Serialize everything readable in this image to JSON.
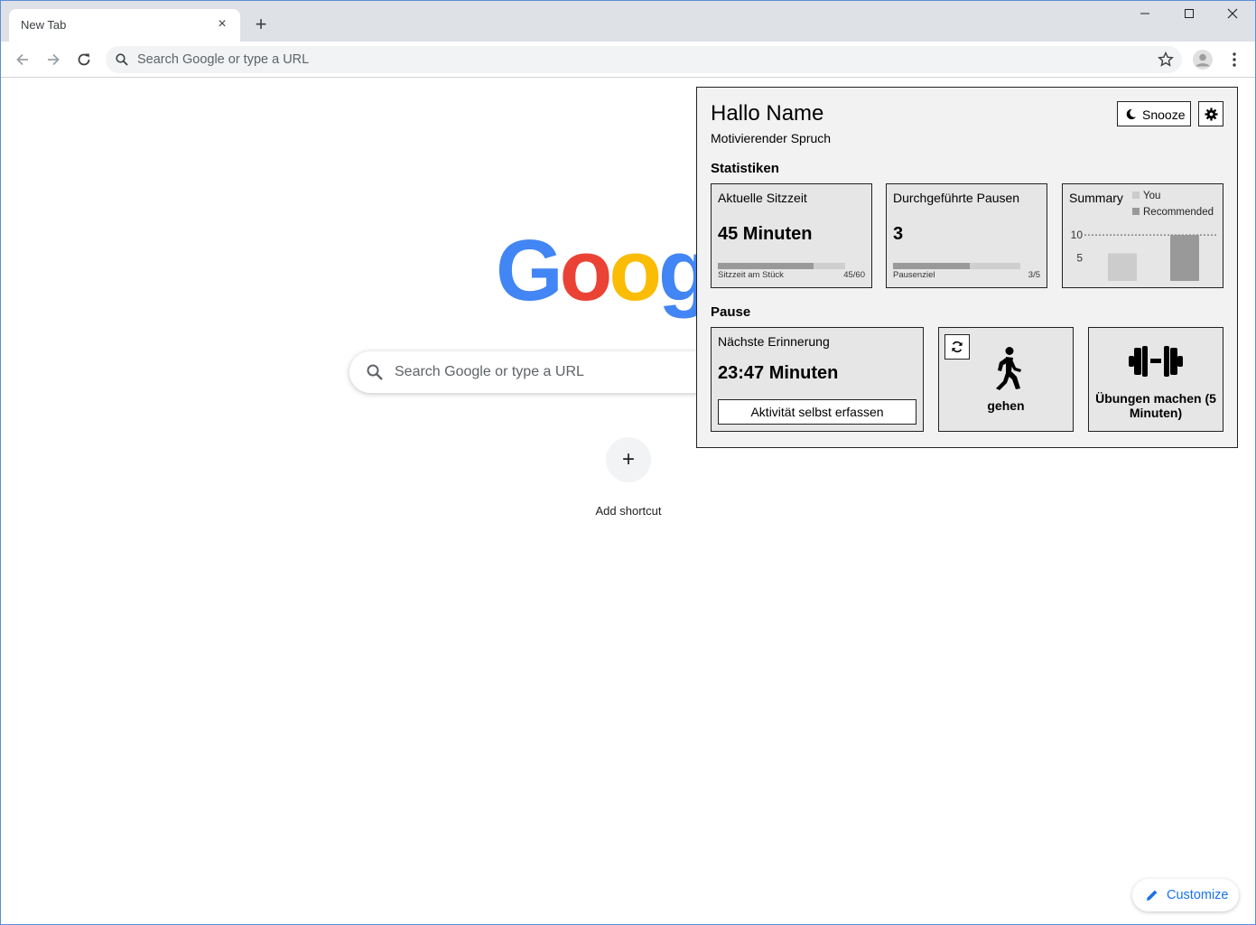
{
  "browser": {
    "tab_title": "New Tab",
    "tab_close": "×",
    "new_tab": "+",
    "window_controls": {
      "minimize": "—",
      "maximize": "☐",
      "close": "✕"
    },
    "omnibox_placeholder": "Search Google or type a URL",
    "icons": [
      "back-icon",
      "forward-icon",
      "reload-icon",
      "search-icon",
      "star-icon",
      "avatar-icon",
      "menu-dots-icon"
    ]
  },
  "ntp": {
    "logo_letters": [
      "G",
      "o",
      "o",
      "g"
    ],
    "logo_colors": [
      "#4285f4",
      "#ea4335",
      "#fbbc05",
      "#4285f4"
    ],
    "search_placeholder": "Search Google or type a URL",
    "add_shortcut_icon": "+",
    "add_shortcut_label": "Add shortcut",
    "customize_label": "Customize"
  },
  "panel": {
    "greeting": "Hallo Name",
    "motto": "Motivierender Spruch",
    "snooze_label": "Snooze",
    "statistics_title": "Statistiken",
    "sitting_card": {
      "title": "Aktuelle Sitzzeit",
      "value": "45 Minuten",
      "bar_label": "Sitzzeit am Stück",
      "bar_value": "45/60",
      "progress": 0.75
    },
    "breaks_card": {
      "title": "Durchgeführte Pausen",
      "value": "3",
      "bar_label": "Pausenziel",
      "bar_value": "3/5",
      "progress": 0.6
    },
    "summary_card": {
      "title": "Summary",
      "legend": [
        {
          "label": "You",
          "color": "#cccccc"
        },
        {
          "label": "Recommended",
          "color": "#999999"
        }
      ],
      "tick_10": "10",
      "tick_5": "5"
    },
    "pause_title": "Pause",
    "reminder_card": {
      "title": "Nächste Erinnerung",
      "value": "23:47 Minuten",
      "button_label": "Aktivität selbst erfassen"
    },
    "walk_card": {
      "label": "gehen"
    },
    "exercise_card": {
      "label": "Übungen machen (5 Minuten)"
    },
    "colors": {
      "panel_bg": "#f2f2f2",
      "card_bg": "#e6e6e6",
      "bar_fill": "#999999",
      "bar_track": "#cfcfcf"
    }
  },
  "chart_data": {
    "type": "bar",
    "title": "Summary",
    "categories": [
      "You",
      "Recommended"
    ],
    "values": [
      6,
      10
    ],
    "yticks": [
      "5",
      "10"
    ],
    "ylim": [
      0,
      11
    ],
    "reference_line": 10,
    "legend_placement": "top-right"
  }
}
